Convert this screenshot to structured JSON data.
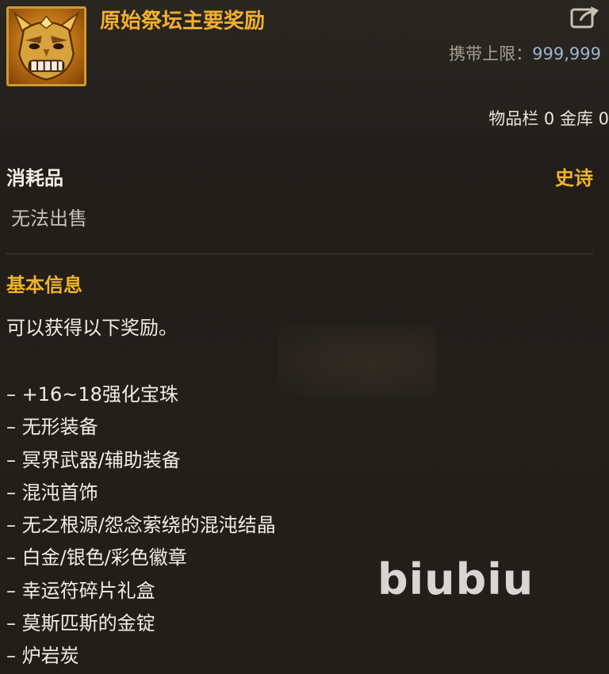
{
  "item": {
    "name": "原始祭坛主要奖励",
    "icon": "golden-demon-mask-icon",
    "carry_limit_label": "携带上限：",
    "carry_limit_value": "999,999",
    "storage_text": "物品栏 0 金库 0"
  },
  "meta": {
    "type": "消耗品",
    "rarity": "史诗",
    "sell_status": "无法出售"
  },
  "section": {
    "title": "基本信息",
    "description": "可以获得以下奖励。"
  },
  "rewards": [
    "– +16~18强化宝珠",
    "– 无形装备",
    "– 冥界武器/辅助装备",
    "– 混沌首饰",
    "– 无之根源/怨念萦绕的混沌结晶",
    "– 白金/银色/彩色徽章",
    "– 幸运符碎片礼盒",
    "– 莫斯匹斯的金锭",
    "– 炉岩炭"
  ],
  "watermark": "biubiu",
  "colors": {
    "title": "#f2b02c",
    "rarity_epic": "#efb42a",
    "carry_value": "#9fb3cf",
    "text": "#f1ede5",
    "background": "#221d17"
  }
}
